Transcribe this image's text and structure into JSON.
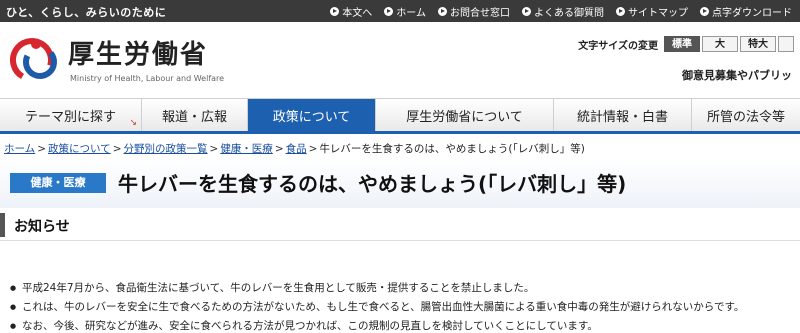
{
  "topbar": {
    "tagline": "ひと、くらし、みらいのために",
    "links": [
      {
        "label": "本文へ",
        "icon": "arrow-right-icon"
      },
      {
        "label": "ホーム",
        "icon": "arrow-right-icon"
      },
      {
        "label": "お問合せ窓口",
        "icon": "arrow-right-icon"
      },
      {
        "label": "よくある御質問",
        "icon": "arrow-right-icon"
      },
      {
        "label": "サイトマップ",
        "icon": "arrow-right-icon"
      },
      {
        "label": "点字ダウンロード",
        "icon": "arrow-right-icon"
      }
    ]
  },
  "header": {
    "site_name": "厚生労働省",
    "site_sub": "Ministry of Health, Labour and Welfare",
    "logo_icon": "mhlw-logo-icon",
    "colors": {
      "logo_red": "#d7262d",
      "logo_blue": "#1e5aa8"
    }
  },
  "fontsize": {
    "label": "文字サイズの変更",
    "options": [
      "標準",
      "大",
      "特大"
    ],
    "selected": "標準"
  },
  "opinion_link": "御意見募集やパブリッ",
  "nav": {
    "items": [
      "テーマ別に探す",
      "報道・広報",
      "政策について",
      "厚生労働省について",
      "統計情報・白書",
      "所管の法令等"
    ],
    "active": "政策について",
    "accent": "#1e60b0"
  },
  "breadcrumb": {
    "items": [
      "ホーム",
      "政策について",
      "分野別の政策一覧",
      "健康・医療",
      "食品"
    ],
    "current": "牛レバーを生食するのは、やめましょう(「レバ刺し」等)",
    "separator": ">"
  },
  "page": {
    "category": "健康・医療",
    "title": "牛レバーを生食するのは、やめましょう(「レバ刺し」等)"
  },
  "section": {
    "title": "お知らせ",
    "bullets": [
      "平成24年7月から、食品衛生法に基づいて、牛のレバーを生食用として販売・提供することを禁止しました。",
      "これは、牛のレバーを安全に生で食べるための方法がないため、もし生で食べると、腸管出血性大腸菌による重い食中毒の発生が避けられないからです。",
      "なお、今後、研究などが進み、安全に食べられる方法が見つかれば、この規制の見直しを検討していくことにしています。"
    ]
  }
}
